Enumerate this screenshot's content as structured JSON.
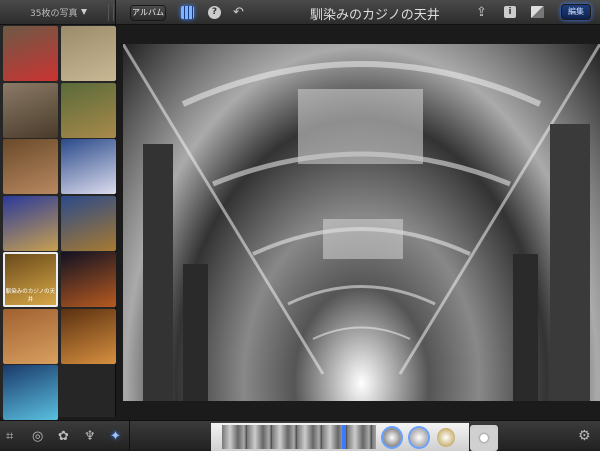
{
  "sidebar_header": {
    "count_label": "35枚の写真"
  },
  "toolbar_top": {
    "albums_label": "アルバム",
    "title": "馴染みのカジノの天井",
    "edit_label": "編集",
    "help_glyph": "?",
    "info_glyph": "i"
  },
  "thumbnails": [
    {
      "colors": [
        "#6b5a45",
        "#c33"
      ]
    },
    {
      "colors": [
        "#9c8b6a",
        "#c8b894"
      ]
    },
    {
      "colors": [
        "#8a7a66",
        "#4a3a2a"
      ]
    },
    {
      "colors": [
        "#5a6a3a",
        "#a88a4a"
      ]
    },
    {
      "colors": [
        "#6a4a2a",
        "#b98860"
      ]
    },
    {
      "colors": [
        "#2a4a8a",
        "#dde"
      ]
    },
    {
      "colors": [
        "#2a3a9a",
        "#c8a050"
      ]
    },
    {
      "colors": [
        "#2a4a8a",
        "#a87a30"
      ]
    },
    {
      "colors": [
        "#6a4a1a",
        "#d8a848"
      ],
      "selected": true,
      "caption": "馴染みのカジノの天井"
    },
    {
      "colors": [
        "#111122",
        "#b85a20"
      ]
    },
    {
      "colors": [
        "#a06030",
        "#d8a060"
      ]
    },
    {
      "colors": [
        "#5a3010",
        "#d89040"
      ]
    },
    {
      "colors": [
        "#1a3a6a",
        "#5ac0e0"
      ]
    }
  ],
  "tools": [
    {
      "icon": "crop-icon",
      "glyph": "⌗"
    },
    {
      "icon": "exposure-icon",
      "glyph": "◎"
    },
    {
      "icon": "color-palette-icon",
      "glyph": "✿"
    },
    {
      "icon": "brushes-icon",
      "glyph": "♆"
    },
    {
      "icon": "effects-icon",
      "glyph": "✦",
      "active": true
    }
  ],
  "effect_swatches": [
    "#888",
    "#aaa",
    "#c8b070"
  ]
}
